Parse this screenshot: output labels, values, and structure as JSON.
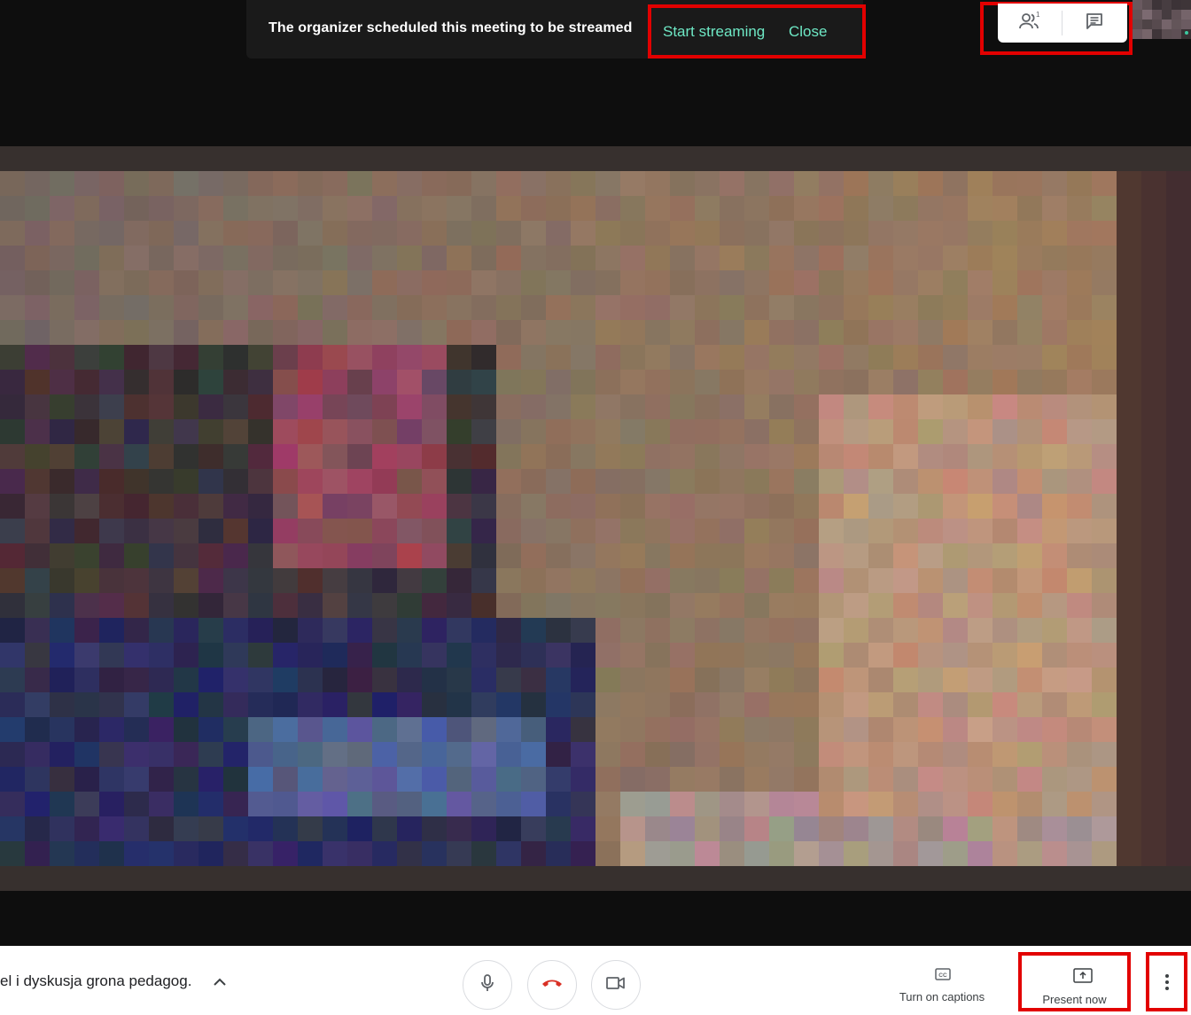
{
  "banner": {
    "message": "The organizer scheduled this meeting to be streamed",
    "start_streaming_label": "Start streaming",
    "close_label": "Close"
  },
  "top_panel": {
    "participant_count": "1",
    "participants_icon": "people-icon",
    "chat_icon": "chat-icon"
  },
  "bottom_bar": {
    "meeting_title": "el i dyskusja grona pedagog.",
    "details_icon": "chevron-up-icon",
    "mic_icon": "microphone-icon",
    "hangup_icon": "phone-hangup-icon",
    "camera_icon": "video-camera-icon",
    "captions_label": "Turn on captions",
    "captions_icon": "closed-captions-icon",
    "present_label": "Present now",
    "present_icon": "present-screen-icon",
    "more_icon": "more-vertical-icon"
  },
  "colors": {
    "accent_link": "#6ee8c5",
    "hangup_red": "#d93025",
    "highlight_box": "#e20000",
    "banner_bg": "#1a1a1a"
  }
}
